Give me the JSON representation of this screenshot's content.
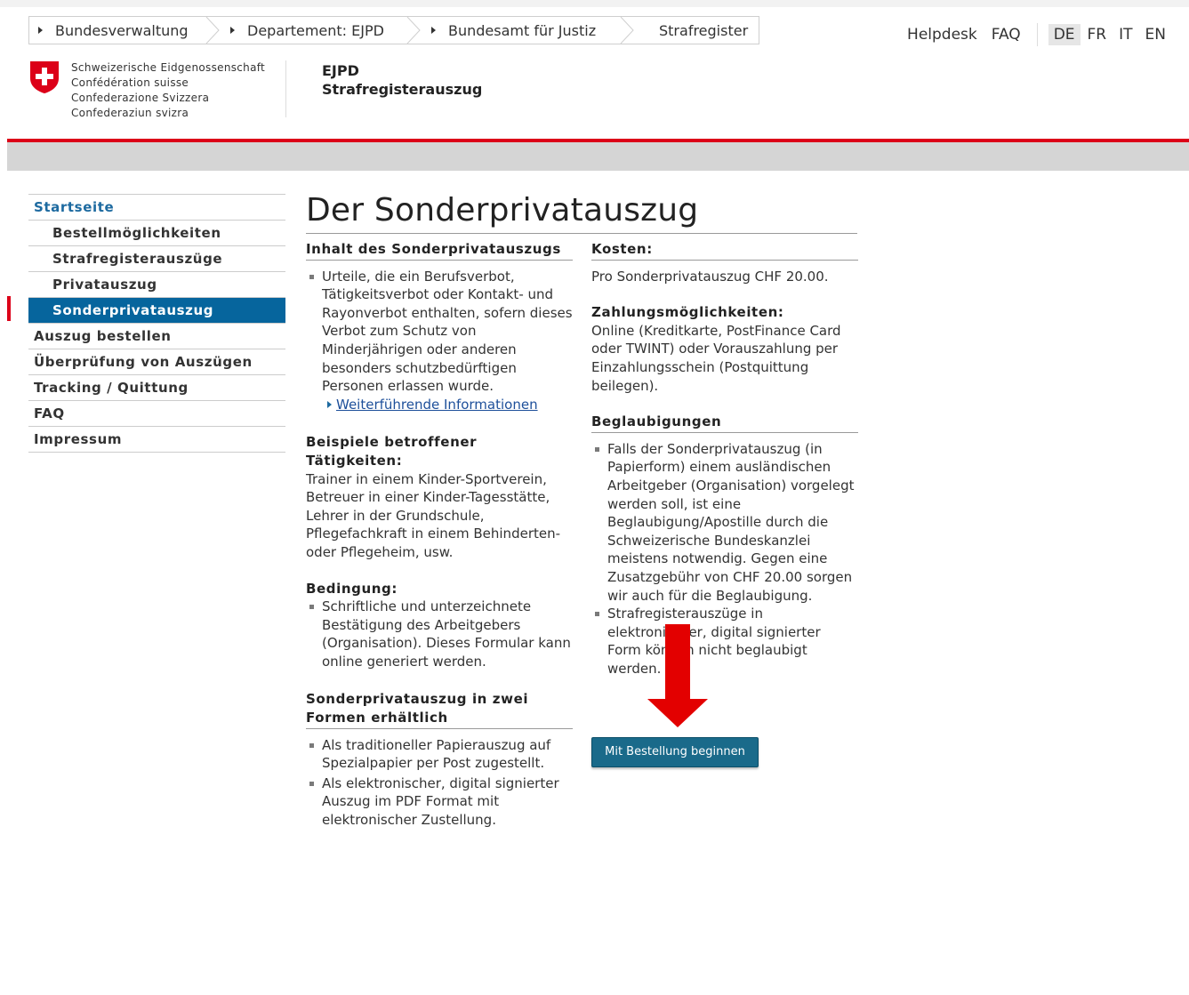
{
  "breadcrumb": [
    "Bundesverwaltung",
    "Departement: EJPD",
    "Bundesamt für Justiz",
    "Strafregister"
  ],
  "toplinks": {
    "helpdesk": "Helpdesk",
    "faq": "FAQ"
  },
  "languages": [
    "DE",
    "FR",
    "IT",
    "EN"
  ],
  "active_language": "DE",
  "confederation": [
    "Schweizerische Eidgenossenschaft",
    "Confédération suisse",
    "Confederazione Svizzera",
    "Confederaziun svizra"
  ],
  "department": {
    "short": "EJPD",
    "app": "Strafregisterauszug"
  },
  "sidebar": [
    {
      "label": "Startseite"
    },
    {
      "label": "Bestellmöglichkeiten"
    },
    {
      "label": "Strafregisterauszüge"
    },
    {
      "label": "Privatauszug"
    },
    {
      "label": "Sonderprivatauszug"
    },
    {
      "label": "Auszug bestellen"
    },
    {
      "label": "Überprüfung von Auszügen"
    },
    {
      "label": "Tracking / Quittung"
    },
    {
      "label": "FAQ"
    },
    {
      "label": "Impressum"
    }
  ],
  "main": {
    "title": "Der Sonderprivatauszug",
    "content": {
      "heading": "Inhalt des Sonderprivatauszugs",
      "item": "Urteile, die ein Berufsverbot, Tätigkeitsverbot oder Kontakt- und Rayonverbot enthalten, sofern dieses Verbot zum Schutz von Minderjährigen oder anderen besonders schutzbedürftigen Personen erlassen wurde.",
      "link": "Weiterführende Informationen"
    },
    "examples": {
      "heading": "Beispiele betroffener Tätigkeiten:",
      "text": "Trainer in einem Kinder-Sportverein, Betreuer in einer Kinder-Tagesstätte, Lehrer in der Grundschule, Pflegefachkraft in einem Behinderten- oder Pflegeheim, usw."
    },
    "condition": {
      "heading": "Bedingung:",
      "item": "Schriftliche und unterzeichnete Bestätigung des Arbeitgebers (Organisation). Dieses Formular kann online generiert werden."
    },
    "forms": {
      "heading": "Sonderprivatauszug in zwei Formen erhältlich",
      "items": [
        "Als traditioneller Papierauszug auf Spezialpapier per Post zugestellt.",
        "Als elektronischer, digital signierter Auszug im PDF Format mit elektronischer Zustellung."
      ]
    },
    "costs": {
      "heading": "Kosten:",
      "text": "Pro Sonderprivatauszug CHF 20.00."
    },
    "payment": {
      "heading": "Zahlungsmöglichkeiten:",
      "text": "Online (Kreditkarte, PostFinance Card oder TWINT) oder Vorauszahlung per Einzahlungsschein (Postquittung beilegen)."
    },
    "certification": {
      "heading": "Beglaubigungen",
      "items": [
        "Falls der Sonderprivatauszug (in Papierform) einem ausländischen Arbeitgeber (Organisation) vorgelegt werden soll, ist eine Beglaubigung/Apostille durch die Schweizerische Bundeskanzlei meistens notwendig. Gegen eine Zusatzgebühr von CHF 20.00 sorgen wir auch für die Beglaubigung.",
        "Strafregisterauszüge in elektronischer, digital signierter Form können nicht beglaubigt werden."
      ]
    },
    "button": "Mit Bestellung beginnen"
  },
  "colors": {
    "accent_red": "#dc0018",
    "nav_active": "#06659d",
    "button": "#1a6a8a",
    "arrow": "#e30000"
  }
}
